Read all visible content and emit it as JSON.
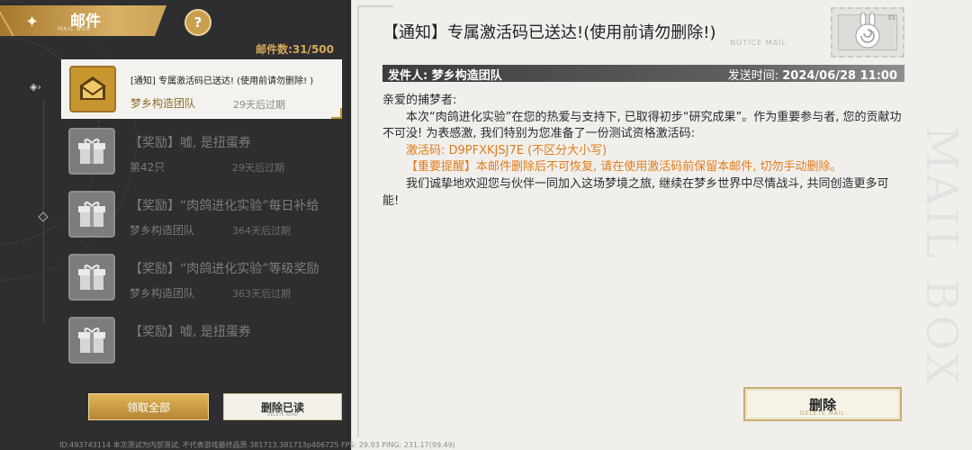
{
  "sidebar": {
    "title": "邮件",
    "subtitle": "MAIL BOX",
    "mail_count": "邮件数:31/500",
    "items": [
      {
        "subject": "[通知] 专属激活码已送达! (使用前请勿删除! )",
        "sender": "梦乡构造团队",
        "expire": "29天后过期",
        "state": "active",
        "icon": "envelope-icon"
      },
      {
        "subject": "【奖励】嘘, 是扭蛋券",
        "sender": "第42只",
        "expire": "29天后过期",
        "state": "read",
        "icon": "gift-box-icon"
      },
      {
        "subject": "【奖励】“肉鸽进化实验”每日补给",
        "sender": "梦乡构造团队",
        "expire": "364天后过期",
        "state": "read",
        "icon": "gift-box-icon"
      },
      {
        "subject": "【奖励】“肉鸽进化实验”等级奖励",
        "sender": "梦乡构造团队",
        "expire": "363天后过期",
        "state": "read",
        "icon": "gift-box-icon"
      },
      {
        "subject": "【奖励】嘘, 是扭蛋券",
        "sender": "",
        "expire": "",
        "state": "read",
        "icon": "gift-box-icon"
      }
    ],
    "claim_all_label": "领取全部",
    "delete_read_label": "删除已读",
    "delete_read_sub": "DELETE READ"
  },
  "mail": {
    "title": "【通知】专属激活码已送达!(使用前请勿删除!)",
    "title_sub": "NOTICE MAIL",
    "stamp_number": "03",
    "sender_label": "发件人: 梦乡构造团队",
    "time_prefix": "发送时间: ",
    "time_value": "2024/06/28 11:00",
    "greeting": "亲爱的捕梦者:",
    "para1": "本次“肉鸽进化实验”在您的热爱与支持下, 已取得初步“研究成果”。作为重要参与者, 您的贡献功不可没! 为表感激, 我们特别为您准备了一份测试资格激活码:",
    "code_line": "激活码: D9PFXKJSJ7E (不区分大小写)",
    "warning_line": "【重要提醒】本邮件删除后不可恢复, 请在使用激活码前保留本邮件, 切勿手动删除。",
    "para2": "我们诚挚地欢迎您与伙伴一同加入这场梦境之旅, 继续在梦乡世界中尽情战斗, 共同创造更多可能!",
    "delete_label": "删除",
    "delete_sub": "DELETE MAIL",
    "bg_text": "MAIL BOX"
  },
  "status_bar": "ID:493743114 本次测试为内部测试, 不代表游戏最终品质 381713.381713p406725 FPS: 29.93 PING: 231.17(99.49)",
  "colors": {
    "accent_gold": "#c8962f",
    "warning_orange": "#e07d1c",
    "panel_dark": "#2e2e30",
    "paper": "#f1efec"
  }
}
